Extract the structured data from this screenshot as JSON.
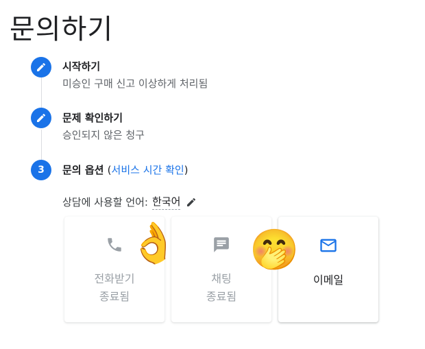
{
  "page": {
    "title": "문의하기"
  },
  "steps": [
    {
      "number": "",
      "title": "시작하기",
      "subtitle": "미승인 구매 신고 이상하게 처리됨"
    },
    {
      "number": "",
      "title": "문제 확인하기",
      "subtitle": "승인되지 않은 청구"
    },
    {
      "number": "3",
      "title": "문의 옵션",
      "link": "서비스 시간 확인"
    }
  ],
  "language": {
    "label": "상담에 사용할 언어:",
    "value": "한국어"
  },
  "options": [
    {
      "label": "전화받기",
      "status": "종료됨",
      "icon": "phone-icon"
    },
    {
      "label": "채팅",
      "status": "종료됨",
      "icon": "chat-icon"
    },
    {
      "label": "이메일",
      "status": "",
      "icon": "mail-icon"
    }
  ],
  "overlays": {
    "emoji_ok": "👌",
    "emoji_shush": "🤭"
  },
  "colors": {
    "accent": "#1a73e8",
    "disabled": "#9aa0a6",
    "line": "#dadce0"
  }
}
